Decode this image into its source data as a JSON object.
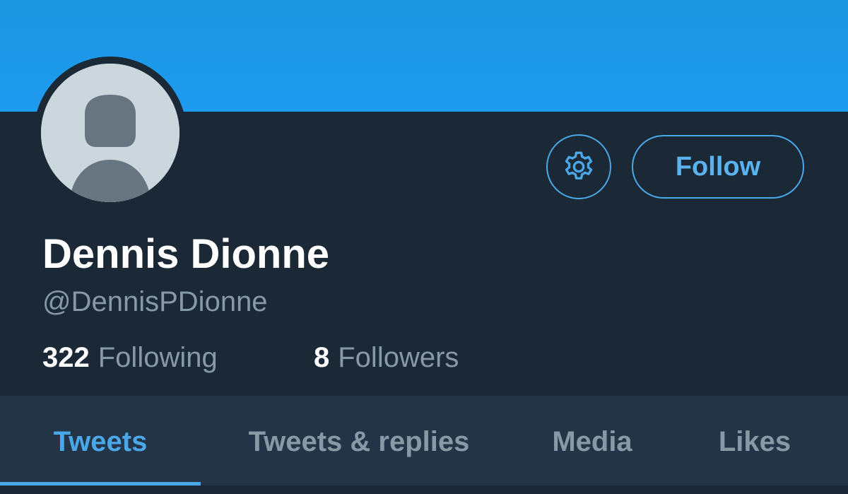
{
  "profile": {
    "display_name": "Dennis Dionne",
    "handle": "@DennisPDionne",
    "follow_label": "Follow"
  },
  "stats": {
    "following_count": "322",
    "following_label": "Following",
    "followers_count": "8",
    "followers_label": "Followers"
  },
  "tabs": [
    {
      "label": "Tweets",
      "active": true
    },
    {
      "label": "Tweets & replies",
      "active": false
    },
    {
      "label": "Media",
      "active": false
    },
    {
      "label": "Likes",
      "active": false
    }
  ],
  "icons": {
    "settings": "gear-icon",
    "avatar": "default-avatar-icon"
  },
  "colors": {
    "banner": "#1d9bf0",
    "background": "#1b2836",
    "tab_bar": "#243447",
    "accent": "#4aa8e8",
    "muted_text": "#8899a6"
  }
}
